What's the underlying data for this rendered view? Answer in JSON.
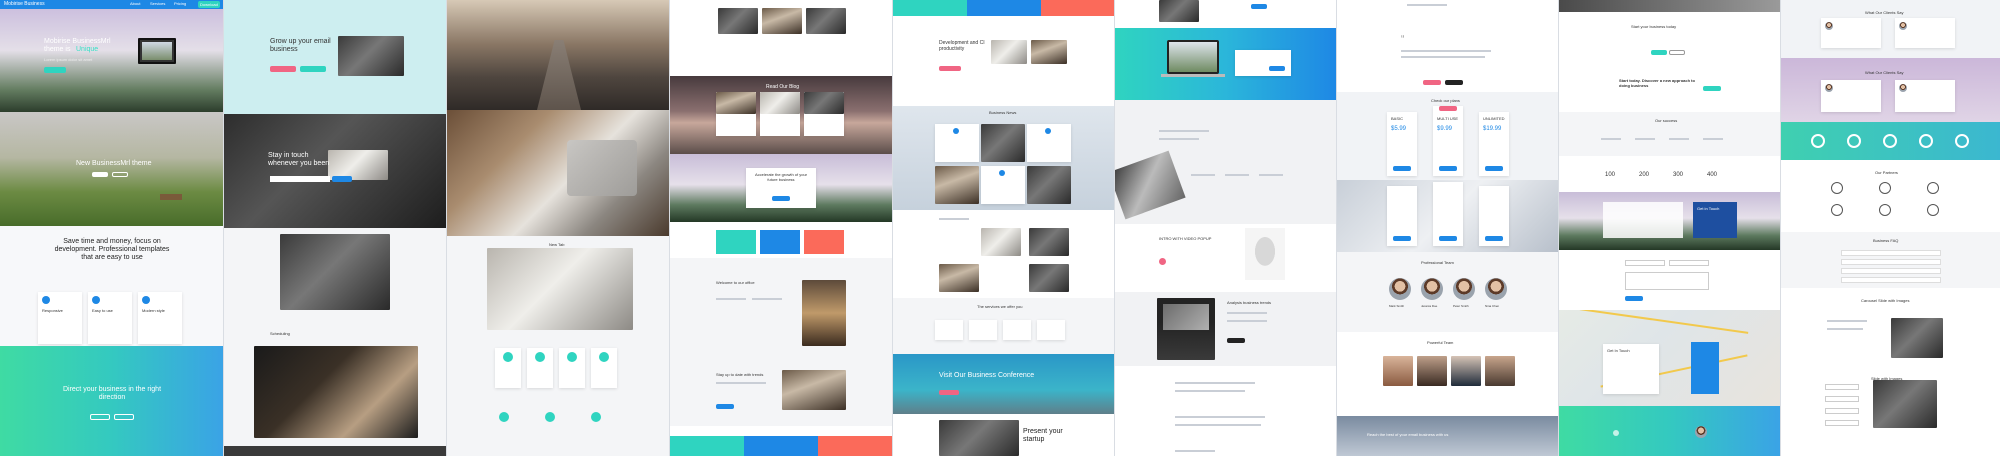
{
  "theme": {
    "accent_blue": "#1e88e5",
    "accent_teal": "#2fd4c0",
    "accent_pink": "#f06583",
    "accent_coral": "#fb6a5a",
    "dark": "#232323"
  },
  "col1": {
    "menu_brand": "Mobirise Business",
    "menu_items": [
      "About",
      "Services",
      "Pricing",
      "Download"
    ],
    "hero_title_1": "Mobirise BusinessMrl",
    "hero_title_2": "theme is",
    "hero_title_highlight": "Unique",
    "hero_text": "Lorem ipsum dolor sit amet",
    "hero_button": "LEARN MORE",
    "new_theme_title": "New BusinessMrl theme",
    "features_title": "Save time and money, focus on development. Professional templates that are easy to use",
    "features": [
      "Responsive",
      "Easy to use",
      "Modern style"
    ],
    "cta_title": "Direct your business in the right direction"
  },
  "col2": {
    "grow_title": "Grow up your email business",
    "stay_title": "Stay in touch whenever you been",
    "scheduling": "Scheduling"
  },
  "col3": {
    "new_tab": "New Tab"
  },
  "col4": {
    "blog_title": "Read Our Blog",
    "growth_text": "Accelerate the growth of your future business",
    "welcome": "Welcome to our office",
    "stay_up": "Stay up to date with trends"
  },
  "col5": {
    "dev_title": "Development and CI productivity",
    "business_news": "Business News",
    "services": "The services we offer you",
    "conference": "Visit Our Business Conference",
    "present_title": "Present your startup"
  },
  "col6": {
    "video_title": "INTRO WITH VIDEO POPUP",
    "analysis_title": "Analysis business trends"
  },
  "col7": {
    "pricing_title": "Check our plans",
    "plans": [
      {
        "name": "BASIC",
        "price": "$5.99"
      },
      {
        "name": "MULTI USE",
        "price": "$9.99"
      },
      {
        "name": "UNLIMITED",
        "price": "$19.99"
      }
    ],
    "team_title": "Professional Team",
    "team": [
      "Mark Smith",
      "Jessica Doe",
      "Peter Smith",
      "Nina Chen"
    ],
    "team2_title": "Powerful Team",
    "footer_text": "Reach the best of your email business with us"
  },
  "col8": {
    "cta_text": "Start your business today",
    "start_title": "Start today. Discover a new approach to doing business",
    "counts_title": "Our success",
    "counts": [
      "100",
      "200",
      "300",
      "400"
    ],
    "get_in_touch": "Get in Touch",
    "contact_title": "Get In Touch"
  },
  "col9": {
    "clients_title_1": "What Our Clients Say",
    "clients_title_2": "What Our Clients Say",
    "partners_title": "Our Partners",
    "faq_title": "Business FAQ",
    "carousel_title_1": "Carousel Slide with Images",
    "carousel_title_2": "Slide with Images"
  }
}
